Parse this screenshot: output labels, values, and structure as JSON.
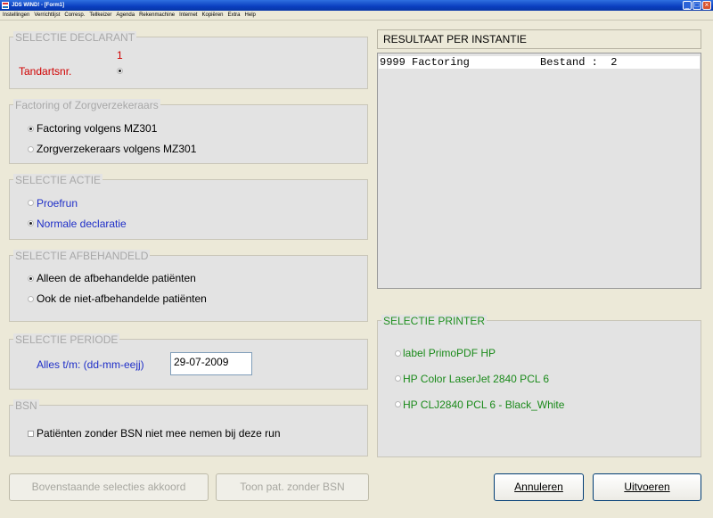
{
  "window": {
    "title": "JDS WIND! - [Form1]"
  },
  "window_buttons": {
    "minimize": "_",
    "restore": "□",
    "close": "×"
  },
  "menu": [
    "Instellingen",
    "Verrichtlijst",
    "Corresp.",
    "Tellkeizer",
    "Agenda",
    "Rekenmachine",
    "Internet",
    "Kopiëren",
    "Extra",
    "Help"
  ],
  "declarant": {
    "legend": "SELECTIE DECLARANT",
    "count": "1",
    "label": "Tandartsnr."
  },
  "factoring": {
    "legend": "Factoring of Zorgverzekeraars",
    "options": [
      "Factoring volgens MZ301",
      "Zorgverzekeraars volgens MZ301"
    ],
    "selected_index": 0
  },
  "actie": {
    "legend": "SELECTIE ACTIE",
    "options": [
      "Proefrun",
      "Normale declaratie"
    ],
    "selected_index": 1
  },
  "afbehandeld": {
    "legend": "SELECTIE AFBEHANDELD",
    "options": [
      "Alleen de afbehandelde patiënten",
      "Ook de niet-afbehandelde patiënten"
    ],
    "selected_index": 0
  },
  "periode": {
    "legend": "SELECTIE PERIODE",
    "label": "Alles t/m: (dd-mm-eejj)",
    "value": "29-07-2009"
  },
  "bsn": {
    "legend": "BSN",
    "checkbox_label": "Patiënten zonder BSN niet mee nemen bij deze run"
  },
  "result": {
    "header": "RESULTAAT PER INSTANTIE",
    "rows": [
      "9999 Factoring           Bestand :  2"
    ]
  },
  "printer": {
    "legend": "SELECTIE PRINTER",
    "options": [
      "label PrimoPDF HP",
      "HP Color LaserJet 2840 PCL 6",
      "HP CLJ2840 PCL 6 - Black_White"
    ]
  },
  "buttons": {
    "accept": "Bovenstaande selecties akkoord",
    "show": "Toon pat. zonder BSN",
    "cancel": "Annuleren",
    "run": "Uitvoeren"
  }
}
